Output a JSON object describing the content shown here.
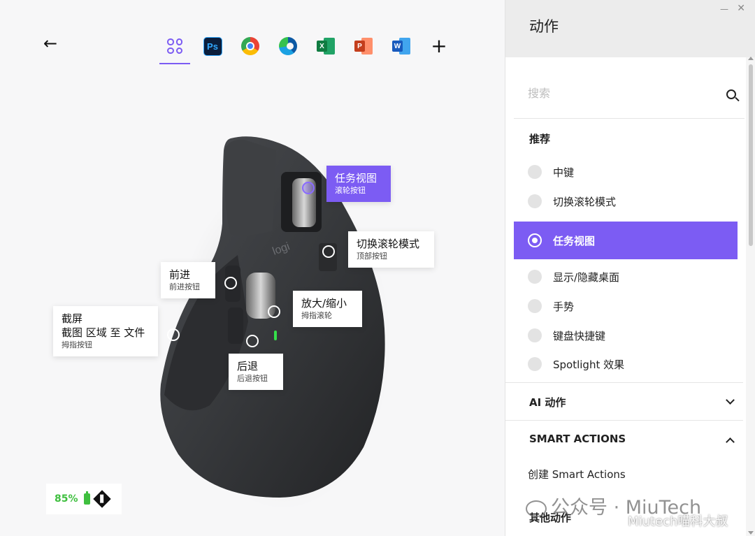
{
  "window": {
    "minimize_glyph": "—",
    "close_glyph": "✕"
  },
  "nav": {
    "back_glyph": "←",
    "app_tabs": [
      {
        "name": "all-apps",
        "icon": "grid-icon",
        "active": true
      },
      {
        "name": "photoshop",
        "icon": "photoshop-icon",
        "text": "Ps"
      },
      {
        "name": "chrome",
        "icon": "chrome-icon"
      },
      {
        "name": "edge",
        "icon": "edge-icon"
      },
      {
        "name": "excel",
        "icon": "excel-icon",
        "text": "X"
      },
      {
        "name": "powerpoint",
        "icon": "powerpoint-icon",
        "text": "P"
      },
      {
        "name": "word",
        "icon": "word-icon",
        "text": "W"
      }
    ],
    "add_glyph": "+"
  },
  "mouse": {
    "logo": "logi",
    "labels": {
      "task_view": {
        "title": "任务视图",
        "sub": "滚轮按钮"
      },
      "scroll_mode": {
        "title": "切换滚轮模式",
        "sub": "顶部按钮"
      },
      "forward": {
        "title": "前进",
        "sub": "前进按钮"
      },
      "zoom": {
        "title": "放大/缩小",
        "sub": "拇指滚轮"
      },
      "screenshot": {
        "title": "截屏",
        "title2": "截图 区域 至 文件",
        "sub": "拇指按钮"
      },
      "back": {
        "title": "后退",
        "sub": "后退按钮"
      }
    }
  },
  "battery": {
    "percent": "85%"
  },
  "panel": {
    "title": "动作",
    "search_placeholder": "搜索",
    "recommend_title": "推荐",
    "options": [
      {
        "label": "中键",
        "selected": false
      },
      {
        "label": "切换滚轮模式",
        "selected": false
      },
      {
        "label": "任务视图",
        "selected": true
      },
      {
        "label": "显示/隐藏桌面",
        "selected": false
      },
      {
        "label": "手势",
        "selected": false
      },
      {
        "label": "键盘快捷键",
        "selected": false
      },
      {
        "label": "Spotlight 效果",
        "selected": false
      }
    ],
    "sections": {
      "ai": "AI 动作",
      "smart": "SMART ACTIONS",
      "create_smart": "创建 Smart Actions",
      "other": "其他动作"
    }
  },
  "watermark": {
    "line1": "公众号 · MiuTech",
    "line2": "Miutech喵科大叔"
  },
  "colors": {
    "accent": "#7c5cf3",
    "battery_green": "#3fbf3f"
  }
}
